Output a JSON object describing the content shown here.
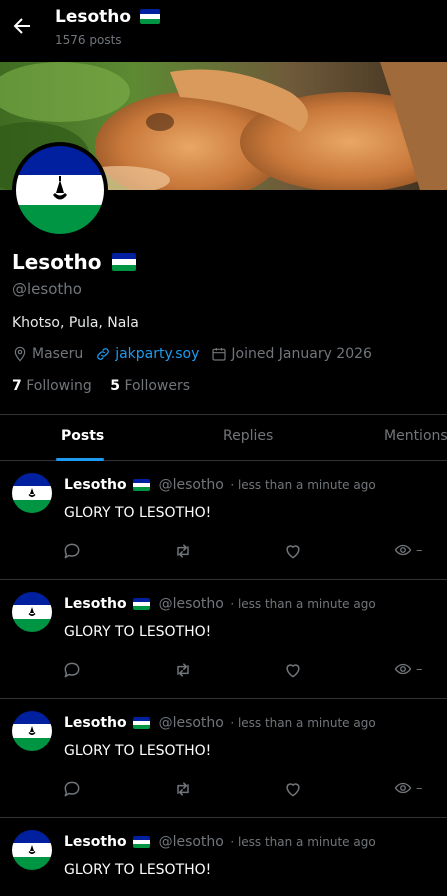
{
  "header": {
    "title": "Lesotho",
    "post_count": "1576 posts"
  },
  "profile": {
    "name": "Lesotho",
    "handle": "@lesotho",
    "bio": "Khotso, Pula, Nala",
    "location": "Maseru",
    "website": "jakparty.soy",
    "joined": "Joined January 2026",
    "following_count": "7",
    "following_label": "Following",
    "followers_count": "5",
    "followers_label": "Followers"
  },
  "tabs": [
    {
      "label": "Posts",
      "active": true
    },
    {
      "label": "Replies",
      "active": false
    },
    {
      "label": "Mentions",
      "active": false
    }
  ],
  "posts": [
    {
      "name": "Lesotho",
      "handle": "@lesotho",
      "time": "· less than a minute ago",
      "text": "GLORY TO LESOTHO!",
      "views": "–"
    },
    {
      "name": "Lesotho",
      "handle": "@lesotho",
      "time": "· less than a minute ago",
      "text": "GLORY TO LESOTHO!",
      "views": "–"
    },
    {
      "name": "Lesotho",
      "handle": "@lesotho",
      "time": "· less than a minute ago",
      "text": "GLORY TO LESOTHO!",
      "views": "–"
    },
    {
      "name": "Lesotho",
      "handle": "@lesotho",
      "time": "· less than a minute ago",
      "text": "GLORY TO LESOTHO!",
      "views": "–"
    }
  ],
  "colors": {
    "flag_blue": "#00209f",
    "flag_white": "#ffffff",
    "flag_green": "#009543",
    "accent": "#1d9bf0"
  }
}
